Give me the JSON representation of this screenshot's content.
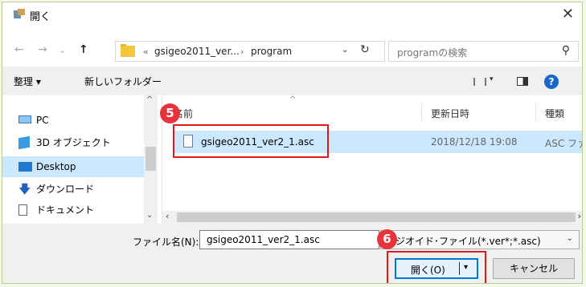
{
  "window": {
    "title": "開く",
    "close_glyph": "✕"
  },
  "nav": {
    "back_glyph": "←",
    "forward_glyph": "→",
    "recent_glyph": "⌄",
    "up_glyph": "↑"
  },
  "address": {
    "overflow": "«",
    "crumbs": [
      "gsigeo2011_ver...",
      "program"
    ],
    "separator": "›",
    "dropdown_glyph": "⌄",
    "refresh_glyph": "↻"
  },
  "search": {
    "placeholder": "programの検索",
    "icon_glyph": "⚲"
  },
  "toolbar": {
    "organize": "整理 ▾",
    "new_folder": "新しいフォルダー",
    "view_dd": "▾",
    "help": "?"
  },
  "sidebar": {
    "items": [
      {
        "label": "PC",
        "icon": "pc-icon"
      },
      {
        "label": "3D オブジェクト",
        "icon": "3d-objects-icon"
      },
      {
        "label": "Desktop",
        "icon": "desktop-icon",
        "selected": true
      },
      {
        "label": "ダウンロード",
        "icon": "download-icon"
      },
      {
        "label": "ドキュメント",
        "icon": "documents-icon"
      }
    ],
    "expand_glyph": "⌄",
    "up_glyph": "^"
  },
  "file_list": {
    "columns": {
      "name": "名前",
      "modified": "更新日時",
      "type": "種類"
    },
    "sort_glyph": "^",
    "rows": [
      {
        "name": "gsigeo2011_ver2_1.asc",
        "modified": "2018/12/18 19:08",
        "type": "ASC ファイ",
        "selected": true
      }
    ],
    "scroll_left": "‹",
    "scroll_right": "›"
  },
  "bottom": {
    "filename_label": "ファイル名(N):",
    "filename_value": "gsigeo2011_ver2_1.asc",
    "filter_value": "ジオイド･ファイル(*.ver*;*.asc)",
    "filter_dropdown_glyph": "⌄",
    "open_label": "開く(O)",
    "open_split_glyph": "▾",
    "cancel_label": "キャンセル"
  },
  "callouts": {
    "step5": "5",
    "step6": "6",
    "color": "#e01a1a"
  },
  "colors": {
    "selection": "#cce8ff",
    "accent": "#0078d7",
    "help": "#1a66c9",
    "badge": "#e8333d"
  }
}
